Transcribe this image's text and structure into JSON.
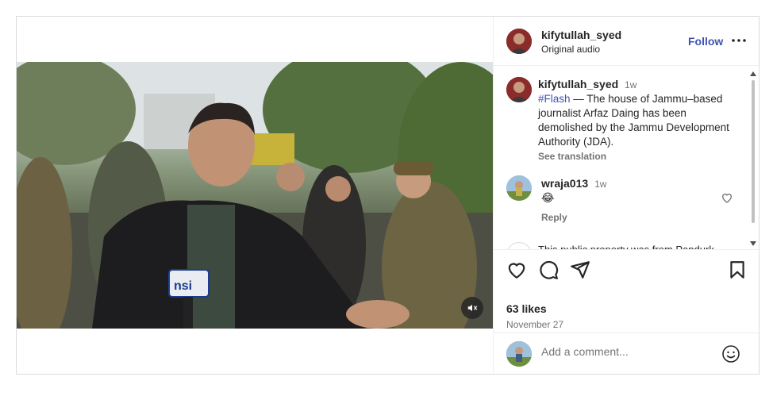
{
  "post": {
    "author": {
      "username": "kifytullah_syed",
      "subtitle": "Original audio",
      "follow_label": "Follow",
      "more_icon": "more-horizontal-icon"
    },
    "caption": {
      "username": "kifytullah_syed",
      "time": "1w",
      "hashtag": "#Flash",
      "text": " — The house of Jammu–based journalist Arfaz Daing has been demolished by the Jammu Development Authority (JDA).",
      "see_translation": "See translation"
    },
    "comments": [
      {
        "username": "wraja013",
        "time": "1w",
        "emoji": "😂",
        "reply_label": "Reply",
        "like_icon": "heart-outline-icon"
      }
    ],
    "partial_comment_text": "This public property was from Pandurk...",
    "actions": {
      "like_icon": "heart-icon",
      "comment_icon": "comment-icon",
      "share_icon": "share-icon",
      "save_icon": "bookmark-icon"
    },
    "likes": "63 likes",
    "date": "November 27",
    "add_comment": {
      "placeholder": "Add a comment...",
      "emoji_icon": "smiley-icon"
    },
    "video": {
      "mute_icon": "muted-speaker-icon",
      "mic_logo": "nsi"
    }
  },
  "colors": {
    "link": "#3f51b5",
    "muted": "#737373",
    "border": "#dbdbdb"
  }
}
